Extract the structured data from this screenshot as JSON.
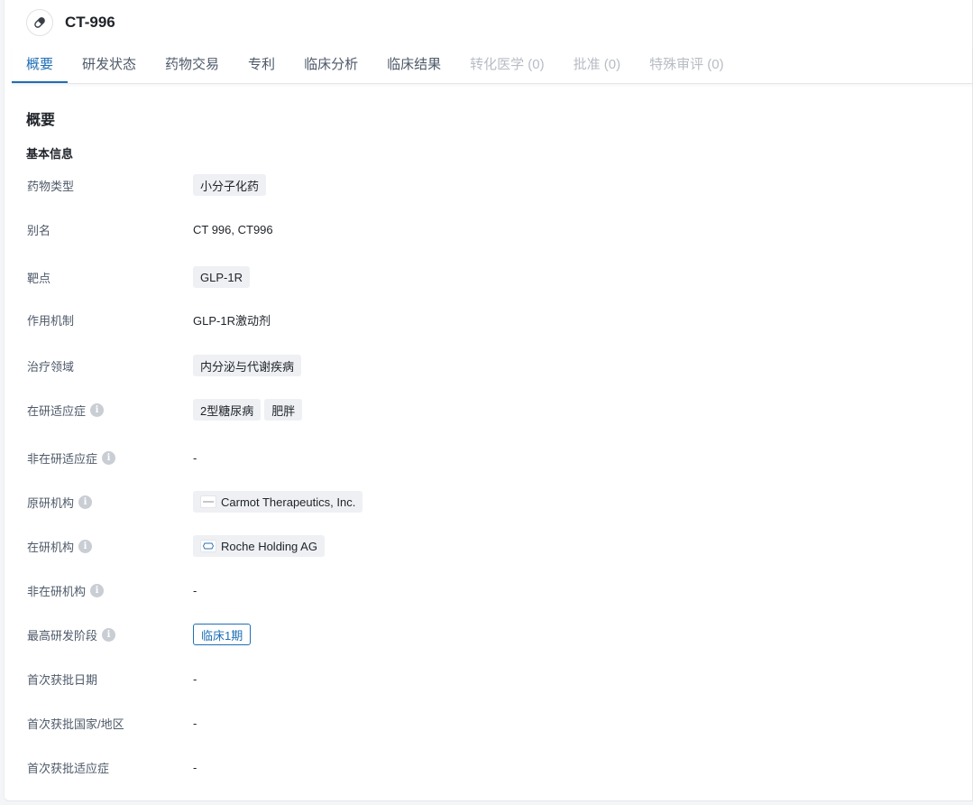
{
  "drug": {
    "title": "CT-996",
    "icon": "pill-icon"
  },
  "tabs": [
    {
      "label": "概要",
      "state": "active"
    },
    {
      "label": "研发状态",
      "state": "normal"
    },
    {
      "label": "药物交易",
      "state": "normal"
    },
    {
      "label": "专利",
      "state": "normal"
    },
    {
      "label": "临床分析",
      "state": "normal"
    },
    {
      "label": "临床结果",
      "state": "normal"
    },
    {
      "label": "转化医学 (0)",
      "state": "disabled"
    },
    {
      "label": "批准 (0)",
      "state": "disabled"
    },
    {
      "label": "特殊审评 (0)",
      "state": "disabled"
    }
  ],
  "overview": {
    "section_title": "概要",
    "basic_info_title": "基本信息",
    "fields": {
      "drug_type": {
        "label": "药物类型",
        "tags": [
          "小分子化药"
        ]
      },
      "alias": {
        "label": "别名",
        "text": "CT 996,  CT996"
      },
      "target": {
        "label": "靶点",
        "tags": [
          "GLP-1R"
        ]
      },
      "mechanism": {
        "label": "作用机制",
        "text": "GLP-1R激动剂"
      },
      "therapeutic_area": {
        "label": "治疗领域",
        "tags": [
          "内分泌与代谢疾病"
        ]
      },
      "active_indications": {
        "label": "在研适应症",
        "tags": [
          "2型糖尿病",
          "肥胖"
        ]
      },
      "inactive_indications": {
        "label": "非在研适应症",
        "text": "-"
      },
      "originator": {
        "label": "原研机构",
        "org": "Carmot Therapeutics, Inc."
      },
      "active_org": {
        "label": "在研机构",
        "org": "Roche Holding AG"
      },
      "inactive_org": {
        "label": "非在研机构",
        "text": "-"
      },
      "highest_phase": {
        "label": "最高研发阶段",
        "phase": "临床1期"
      },
      "first_approval_date": {
        "label": "首次获批日期",
        "text": "-"
      },
      "first_approval_country": {
        "label": "首次获批国家/地区",
        "text": "-"
      },
      "first_approval_indication": {
        "label": "首次获批适应症",
        "text": "-"
      }
    }
  },
  "colors": {
    "accent": "#1f6fb5",
    "tag_bg": "#eef0f3",
    "disabled_tab": "#b8bcc4"
  }
}
